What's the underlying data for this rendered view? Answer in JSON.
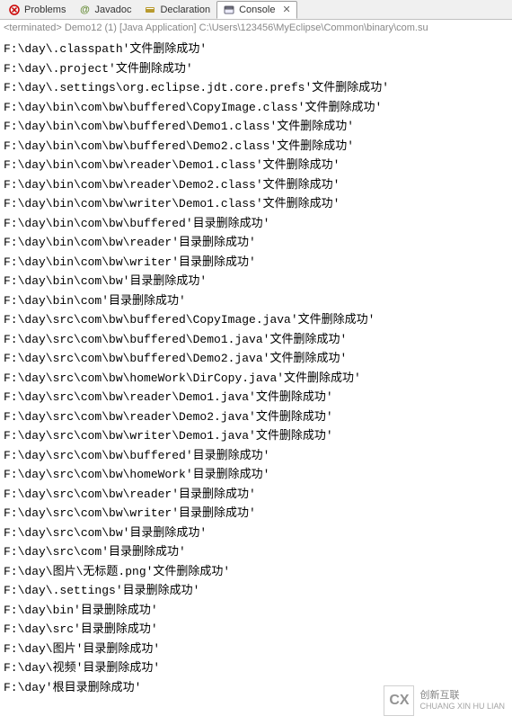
{
  "tabs": [
    {
      "label": "Problems",
      "icon": "problems-icon"
    },
    {
      "label": "Javadoc",
      "icon": "javadoc-icon"
    },
    {
      "label": "Declaration",
      "icon": "declaration-icon"
    },
    {
      "label": "Console",
      "icon": "console-icon",
      "active": true
    }
  ],
  "status": "<terminated> Demo12 (1) [Java Application] C:\\Users\\123456\\MyEclipse\\Common\\binary\\com.su",
  "lines": [
    "F:\\day\\.classpath'文件删除成功'",
    "F:\\day\\.project'文件删除成功'",
    "F:\\day\\.settings\\org.eclipse.jdt.core.prefs'文件删除成功'",
    "F:\\day\\bin\\com\\bw\\buffered\\CopyImage.class'文件删除成功'",
    "F:\\day\\bin\\com\\bw\\buffered\\Demo1.class'文件删除成功'",
    "F:\\day\\bin\\com\\bw\\buffered\\Demo2.class'文件删除成功'",
    "F:\\day\\bin\\com\\bw\\reader\\Demo1.class'文件删除成功'",
    "F:\\day\\bin\\com\\bw\\reader\\Demo2.class'文件删除成功'",
    "F:\\day\\bin\\com\\bw\\writer\\Demo1.class'文件删除成功'",
    "F:\\day\\bin\\com\\bw\\buffered'目录删除成功'",
    "F:\\day\\bin\\com\\bw\\reader'目录删除成功'",
    "F:\\day\\bin\\com\\bw\\writer'目录删除成功'",
    "F:\\day\\bin\\com\\bw'目录删除成功'",
    "F:\\day\\bin\\com'目录删除成功'",
    "F:\\day\\src\\com\\bw\\buffered\\CopyImage.java'文件删除成功'",
    "F:\\day\\src\\com\\bw\\buffered\\Demo1.java'文件删除成功'",
    "F:\\day\\src\\com\\bw\\buffered\\Demo2.java'文件删除成功'",
    "F:\\day\\src\\com\\bw\\homeWork\\DirCopy.java'文件删除成功'",
    "F:\\day\\src\\com\\bw\\reader\\Demo1.java'文件删除成功'",
    "F:\\day\\src\\com\\bw\\reader\\Demo2.java'文件删除成功'",
    "F:\\day\\src\\com\\bw\\writer\\Demo1.java'文件删除成功'",
    "F:\\day\\src\\com\\bw\\buffered'目录删除成功'",
    "F:\\day\\src\\com\\bw\\homeWork'目录删除成功'",
    "F:\\day\\src\\com\\bw\\reader'目录删除成功'",
    "F:\\day\\src\\com\\bw\\writer'目录删除成功'",
    "F:\\day\\src\\com\\bw'目录删除成功'",
    "F:\\day\\src\\com'目录删除成功'",
    "F:\\day\\图片\\无标题.png'文件删除成功'",
    "F:\\day\\.settings'目录删除成功'",
    "F:\\day\\bin'目录删除成功'",
    "F:\\day\\src'目录删除成功'",
    "F:\\day\\图片'目录删除成功'",
    "F:\\day\\视频'目录删除成功'",
    "F:\\day'根目录删除成功'"
  ],
  "close_x": "✕",
  "watermark": {
    "logo": "CX",
    "zh": "创新互联",
    "en": "CHUANG XIN HU LIAN"
  }
}
